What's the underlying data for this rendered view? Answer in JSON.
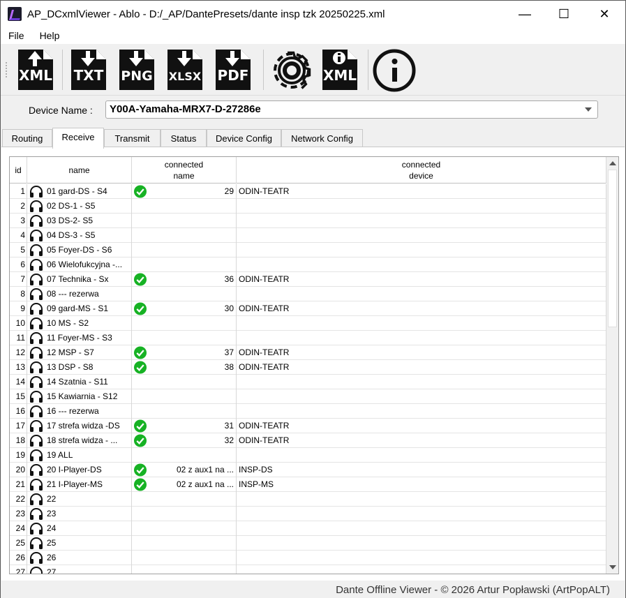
{
  "window": {
    "title": "AP_DCxmlViewer - Ablo - D:/_AP/DantePresets/dante insp tzk 20250225.xml"
  },
  "window_controls": {
    "minimize": "—",
    "maximize": "☐",
    "close": "✕"
  },
  "menu": {
    "file": "File",
    "help": "Help"
  },
  "toolbar": {
    "buttons": [
      {
        "name": "export-xml-icon",
        "label": "XML"
      },
      {
        "name": "export-txt-icon",
        "label": "TXT"
      },
      {
        "name": "export-png-icon",
        "label": "PNG"
      },
      {
        "name": "export-xlsx-icon",
        "label": "XLSX"
      },
      {
        "name": "export-pdf-icon",
        "label": "PDF"
      },
      {
        "name": "settings-gear-icon",
        "label": ""
      },
      {
        "name": "xml-info-icon",
        "label": "XML"
      },
      {
        "name": "about-info-icon",
        "label": ""
      }
    ]
  },
  "device": {
    "label": "Device Name :",
    "value": "Y00A-Yamaha-MRX7-D-27286e"
  },
  "tabs": [
    "Routing",
    "Receive",
    "Transmit",
    "Status",
    "Device Config",
    "Network Config"
  ],
  "active_tab": "Receive",
  "table": {
    "headers": {
      "id": "id",
      "name": "name",
      "cname_1": "connected",
      "cname_2": "name",
      "cdev_1": "connected",
      "cdev_2": "device"
    },
    "rows": [
      {
        "id": "1",
        "name": "01 gard-DS - S4",
        "ok": true,
        "cname": "29",
        "cdev": "ODIN-TEATR"
      },
      {
        "id": "2",
        "name": "02 DS-1 - S5",
        "ok": false,
        "cname": "",
        "cdev": ""
      },
      {
        "id": "3",
        "name": "03 DS-2- S5",
        "ok": false,
        "cname": "",
        "cdev": ""
      },
      {
        "id": "4",
        "name": "04 DS-3 - S5",
        "ok": false,
        "cname": "",
        "cdev": ""
      },
      {
        "id": "5",
        "name": "05 Foyer-DS - S6",
        "ok": false,
        "cname": "",
        "cdev": ""
      },
      {
        "id": "6",
        "name": "06 Wielofukcyjna -...",
        "ok": false,
        "cname": "",
        "cdev": ""
      },
      {
        "id": "7",
        "name": "07 Technika - Sx",
        "ok": true,
        "cname": "36",
        "cdev": "ODIN-TEATR"
      },
      {
        "id": "8",
        "name": "08 --- rezerwa",
        "ok": false,
        "cname": "",
        "cdev": ""
      },
      {
        "id": "9",
        "name": "09 gard-MS - S1",
        "ok": true,
        "cname": "30",
        "cdev": "ODIN-TEATR"
      },
      {
        "id": "10",
        "name": "10 MS - S2",
        "ok": false,
        "cname": "",
        "cdev": ""
      },
      {
        "id": "11",
        "name": "11 Foyer-MS - S3",
        "ok": false,
        "cname": "",
        "cdev": ""
      },
      {
        "id": "12",
        "name": "12 MSP - S7",
        "ok": true,
        "cname": "37",
        "cdev": "ODIN-TEATR"
      },
      {
        "id": "13",
        "name": "13 DSP - S8",
        "ok": true,
        "cname": "38",
        "cdev": "ODIN-TEATR"
      },
      {
        "id": "14",
        "name": "14 Szatnia - S11",
        "ok": false,
        "cname": "",
        "cdev": ""
      },
      {
        "id": "15",
        "name": "15 Kawiarnia - S12",
        "ok": false,
        "cname": "",
        "cdev": ""
      },
      {
        "id": "16",
        "name": "16 --- rezerwa",
        "ok": false,
        "cname": "",
        "cdev": ""
      },
      {
        "id": "17",
        "name": "17 strefa widza -DS",
        "ok": true,
        "cname": "31",
        "cdev": "ODIN-TEATR"
      },
      {
        "id": "18",
        "name": "18 strefa widza - ...",
        "ok": true,
        "cname": "32",
        "cdev": "ODIN-TEATR"
      },
      {
        "id": "19",
        "name": "19 ALL",
        "ok": false,
        "cname": "",
        "cdev": ""
      },
      {
        "id": "20",
        "name": "20 I-Player-DS",
        "ok": true,
        "cname": "02 z aux1 na ...",
        "cdev": "INSP-DS"
      },
      {
        "id": "21",
        "name": "21 I-Player-MS",
        "ok": true,
        "cname": "02 z aux1 na ...",
        "cdev": "INSP-MS"
      },
      {
        "id": "22",
        "name": "22",
        "ok": false,
        "cname": "",
        "cdev": ""
      },
      {
        "id": "23",
        "name": "23",
        "ok": false,
        "cname": "",
        "cdev": ""
      },
      {
        "id": "24",
        "name": "24",
        "ok": false,
        "cname": "",
        "cdev": ""
      },
      {
        "id": "25",
        "name": "25",
        "ok": false,
        "cname": "",
        "cdev": ""
      },
      {
        "id": "26",
        "name": "26",
        "ok": false,
        "cname": "",
        "cdev": ""
      },
      {
        "id": "27",
        "name": "27",
        "ok": false,
        "cname": "",
        "cdev": ""
      }
    ]
  },
  "status": {
    "text": "Dante Offline Viewer - © 2026 Artur Popławski (ArtPopALT)"
  },
  "colors": {
    "ok_green": "#17b224",
    "icon_dark": "#111111"
  }
}
